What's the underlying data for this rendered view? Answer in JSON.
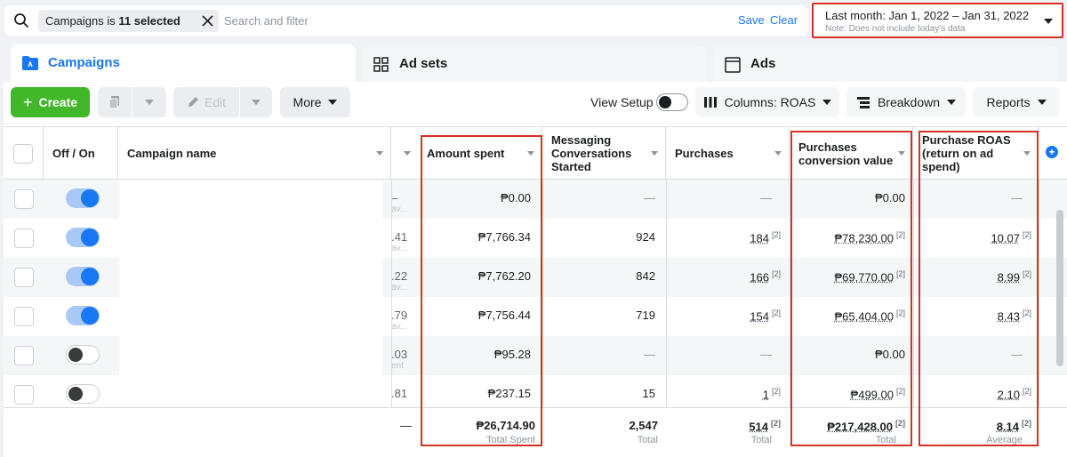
{
  "filter": {
    "chip_prefix": "Campaigns is ",
    "chip_bold": "11 selected",
    "placeholder": "Search and filter",
    "save": "Save",
    "clear": "Clear"
  },
  "date": {
    "range": "Last month: Jan 1, 2022 – Jan 31, 2022",
    "note": "Note: Does not include today's data"
  },
  "tabs": [
    {
      "label": "Campaigns",
      "icon": "folder-icon"
    },
    {
      "label": "Ad sets",
      "icon": "grid-icon"
    },
    {
      "label": "Ads",
      "icon": "ad-frame-icon"
    }
  ],
  "toolbar": {
    "create": "Create",
    "edit": "Edit",
    "more": "More",
    "view_setup": "View Setup",
    "columns": "Columns: ROAS",
    "breakdown": "Breakdown",
    "reports": "Reports"
  },
  "columns": {
    "off_on": "Off / On",
    "campaign_name": "Campaign name",
    "amount_spent": "Amount spent",
    "messaging": "Messaging Conversations Started",
    "purchases": "Purchases",
    "conv_value": "Purchases conversion value",
    "roas": "Purchase ROAS (return on ad spend)"
  },
  "rows": [
    {
      "on": true,
      "frag": "–",
      "frag2": "av...",
      "spent": "₱0.00",
      "msg": "—",
      "purch": "—",
      "value": "₱0.00",
      "roas": "—"
    },
    {
      "on": true,
      "frag": ".41",
      "frag2": "av...",
      "spent": "₱7,766.34",
      "msg": "924",
      "purch": "184",
      "value": "₱78,230.00",
      "roas": "10.07"
    },
    {
      "on": true,
      "frag": ".22",
      "frag2": "av...",
      "spent": "₱7,762.20",
      "msg": "842",
      "purch": "166",
      "value": "₱69,770.00",
      "roas": "8.99"
    },
    {
      "on": true,
      "frag": ".79",
      "frag2": "av...",
      "spent": "₱7,756.44",
      "msg": "719",
      "purch": "154",
      "value": "₱65,404.00",
      "roas": "8.43"
    },
    {
      "on": false,
      "frag": ".03",
      "frag2": "ent",
      "spent": "₱95.28",
      "msg": "—",
      "purch": "—",
      "value": "₱0.00",
      "roas": "—"
    },
    {
      "on": false,
      "frag": ".81",
      "frag2": "",
      "spent": "₱237.15",
      "msg": "15",
      "purch": "1",
      "value": "₱499.00",
      "roas": "2.10"
    }
  ],
  "sup": "[2]",
  "totals": {
    "frag": "—",
    "spent": "₱26,714.90",
    "spent_label": "Total Spent",
    "msg": "2,547",
    "msg_label": "Total",
    "purch": "514",
    "purch_label": "Total",
    "value": "₱217,428.00",
    "value_label": "Total",
    "roas": "8.14",
    "roas_label": "Average"
  },
  "colors": {
    "accent": "#1877f2",
    "create": "#42b72a",
    "highlight": "#d93025"
  }
}
